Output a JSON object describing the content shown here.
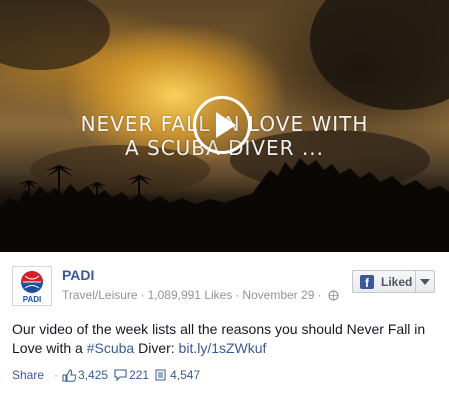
{
  "video": {
    "overlay_line1": "NEVER FALL IN LOVE WITH",
    "overlay_line2": "A SCUBA DIVER ..."
  },
  "page": {
    "name": "PADI",
    "logo_text": "PADI",
    "category": "Travel/Leisure",
    "likes": "1,089,991 Likes",
    "date": "November 29"
  },
  "like_button": {
    "label": "Liked",
    "icon_letter": "f"
  },
  "post": {
    "text_before": "Our video of the week lists all the reasons you should Never Fall in Love with a ",
    "hashtag": "#Scuba",
    "text_middle": " Diver: ",
    "link": "bit.ly/1sZWkuf"
  },
  "footer": {
    "share_label": "Share",
    "likes_count": "3,425",
    "comments_count": "221",
    "shares_count": "4,547"
  },
  "colors": {
    "brand": "#3b5998",
    "meta": "#90949c",
    "text": "#141823"
  }
}
